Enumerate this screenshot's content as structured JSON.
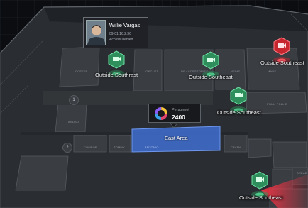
{
  "colors": {
    "camera_normal": "#2f8f5c",
    "camera_alert": "#c7262f",
    "selected_area": "#3f6fd1",
    "background": "#0b0d10"
  },
  "person_card": {
    "name": "Willie Vargas",
    "timestamp": "09-01 16:2:36",
    "status": "Access Denied",
    "avatar_icon": "person-photo"
  },
  "personnel_card": {
    "label": "Personnel",
    "count": "2400",
    "icon": "donut-chart-icon"
  },
  "area": {
    "name": "East Area"
  },
  "cameras": [
    {
      "id": "cam1",
      "label": "Outside Southrast",
      "state": "normal"
    },
    {
      "id": "cam2",
      "label": "Outside Southeast",
      "state": "normal"
    },
    {
      "id": "cam3",
      "label": "Outside Southeast",
      "state": "normal"
    },
    {
      "id": "cam4",
      "label": "Outside Southeast",
      "state": "alert"
    },
    {
      "id": "cam5",
      "label": "Outside Southeast",
      "state": "normal"
    }
  ],
  "room_labels": {
    "r1": "COFFEE",
    "r2": "JONCUST",
    "r3": "DE ACCESSORIES",
    "r4": "NEIHE",
    "r5": "MANE",
    "r6": "POLLI POLLIE",
    "r7": "ANDBO",
    "r8": "COMFOR",
    "r9": "TOMMY",
    "r10": "ANTONIO",
    "r11": "CAVAN",
    "r12": "BREAD"
  },
  "zone_markers": {
    "z1": "1",
    "z2": "2"
  }
}
